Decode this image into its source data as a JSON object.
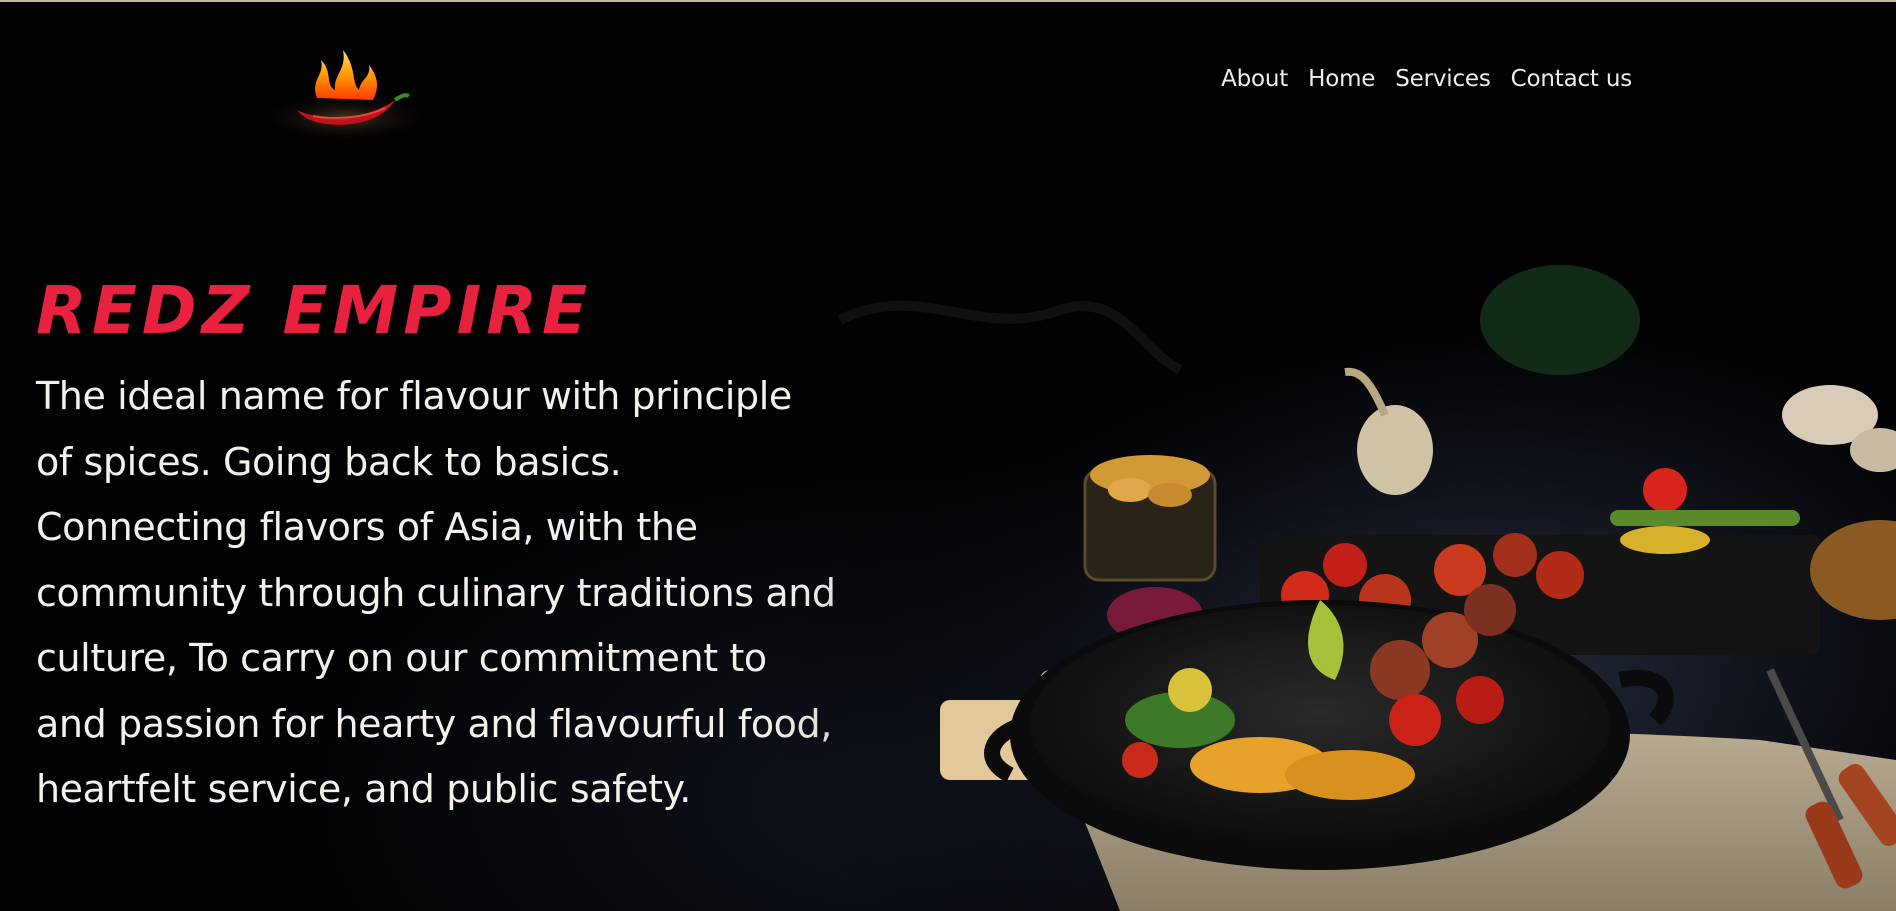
{
  "brand": {
    "logo_icon": "flaming-chili-pepper-icon"
  },
  "nav": {
    "items": [
      {
        "label": "About"
      },
      {
        "label": "Home"
      },
      {
        "label": "Services"
      },
      {
        "label": "Contact us"
      }
    ]
  },
  "hero": {
    "title": "REDZ EMPIRE",
    "description": "The ideal name for flavour with principle of spices. Going back to basics. Connecting flavors of Asia, with the community through culinary traditions and culture, To carry on our commitment to and passion for hearty and flavourful food, heartfelt service, and public safety.",
    "image": "grilled-skewers-vegetables-pan-photo"
  },
  "colors": {
    "background": "#020203",
    "accent": "#e8213f",
    "text": "#f4f1ea",
    "top_border": "#c9b59a"
  }
}
